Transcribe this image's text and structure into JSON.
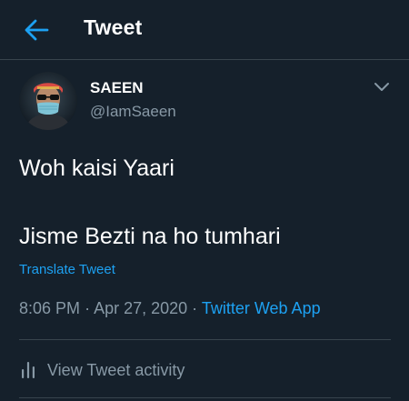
{
  "colors": {
    "background": "#15202b",
    "accent": "#1da1f2",
    "muted_text": "#8899a6",
    "divider": "#38444d"
  },
  "header": {
    "title": "Tweet",
    "back_icon": "arrow-left-icon"
  },
  "author": {
    "name": "SAEEN",
    "handle": "@IamSaeen",
    "avatar_icon": "avatar-person-with-mask"
  },
  "tweet": {
    "line1": "Woh kaisi Yaari",
    "line2": "Jisme Bezti na ho tumhari",
    "translate_label": "Translate Tweet"
  },
  "meta": {
    "time": "8:06 PM",
    "date": "Apr 27, 2020",
    "separator": "·",
    "source": "Twitter Web App"
  },
  "activity": {
    "label": "View Tweet activity",
    "icon": "analytics-bars-icon"
  },
  "more_icon": "chevron-down-icon"
}
